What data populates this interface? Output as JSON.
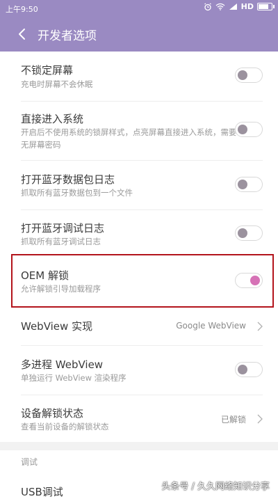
{
  "status": {
    "time": "上午9:50",
    "network": "HD"
  },
  "header": {
    "title": "开发者选项"
  },
  "items": [
    {
      "title": "不锁定屏幕",
      "subtitle": "充电时屏幕不会休眠",
      "toggle": "off"
    },
    {
      "title": "直接进入系统",
      "subtitle": "开启后不使用系统的锁屏样式，点亮屏幕直接进入系统，需要无屏幕密码",
      "toggle": "off"
    },
    {
      "title": "打开蓝牙数据包日志",
      "subtitle": "抓取所有蓝牙数据包到一个文件",
      "toggle": "off"
    },
    {
      "title": "打开蓝牙调试日志",
      "subtitle": "抓取所有蓝牙调试日志",
      "toggle": "off"
    },
    {
      "title": "OEM 解锁",
      "subtitle": "允许解锁引导加载程序",
      "toggle": "on"
    },
    {
      "title": "WebView 实现",
      "value": "Google WebView"
    },
    {
      "title": "多进程 WebView",
      "subtitle": "单独运行 WebView 渲染程序",
      "toggle": "off"
    },
    {
      "title": "设备解锁状态",
      "subtitle": "查看当前设备的解锁状态",
      "value": "已解锁"
    }
  ],
  "section": {
    "label": "调试"
  },
  "next_item": {
    "title": "USB调试"
  },
  "watermark": "头条号 / 久久网络知识分享",
  "colors": {
    "accent": "#9a8ac2",
    "toggle_on": "#d672b6",
    "highlight": "#b3131b"
  }
}
